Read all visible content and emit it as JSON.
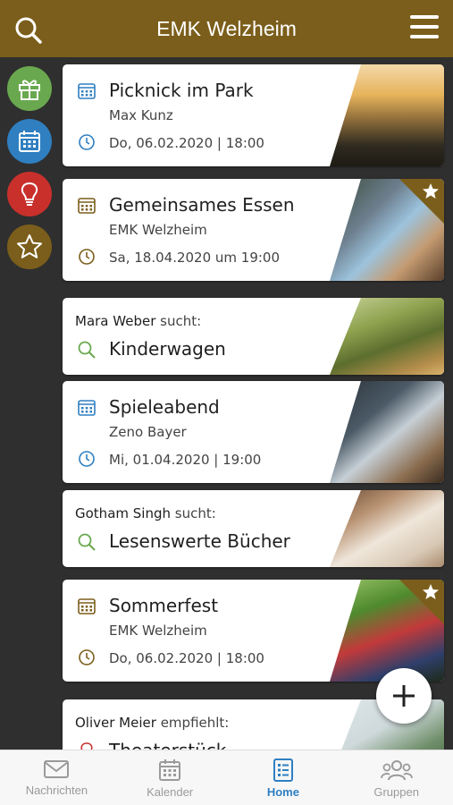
{
  "header": {
    "title": "EMK Welzheim",
    "search_icon": "search-icon",
    "menu_icon": "hamburger-menu-icon",
    "background": "#7b5e1b"
  },
  "rail": [
    {
      "icon": "gift-icon",
      "color": "#6aa84f"
    },
    {
      "icon": "calendar-icon",
      "color": "#2f7fc1"
    },
    {
      "icon": "lightbulb-icon",
      "color": "#c9302c"
    },
    {
      "icon": "star-icon",
      "color": "#7b5e1b"
    }
  ],
  "feed": {
    "picknick": {
      "title": "Picknick im Park",
      "organizer": "Max Kunz",
      "datetime": "Do, 06.02.2020 | 18:00"
    },
    "essen": {
      "title": "Gemeinsames Essen",
      "organizer": "EMK Welzheim",
      "datetime": "Sa, 18.04.2020 um 19:00"
    },
    "kinderwagen": {
      "person": "Mara Weber",
      "verb": "sucht:",
      "item": "Kinderwagen"
    },
    "spieleabend": {
      "title": "Spieleabend",
      "organizer": "Zeno Bayer",
      "datetime": "Mi, 01.04.2020 | 19:00"
    },
    "buecher": {
      "person": "Gotham Singh",
      "verb": "sucht:",
      "item": "Lesenswerte Bücher"
    },
    "sommerfest": {
      "title": "Sommerfest",
      "organizer": "EMK Welzheim",
      "datetime": "Do, 06.02.2020 | 18:00"
    },
    "theater": {
      "person": "Oliver Meier",
      "verb": "empfiehlt:",
      "item": "Theaterstück"
    }
  },
  "tabs": [
    {
      "label": "Nachrichten",
      "icon": "mail-icon"
    },
    {
      "label": "Kalender",
      "icon": "calendar-icon"
    },
    {
      "label": "Home",
      "icon": "list-icon",
      "active": true
    },
    {
      "label": "Gruppen",
      "icon": "group-icon"
    }
  ],
  "colors": {
    "event_blue": "#2f7fc1",
    "event_gold": "#7b5e1b",
    "search_green": "#6aa84f",
    "active_tab": "#2f7fc1"
  }
}
